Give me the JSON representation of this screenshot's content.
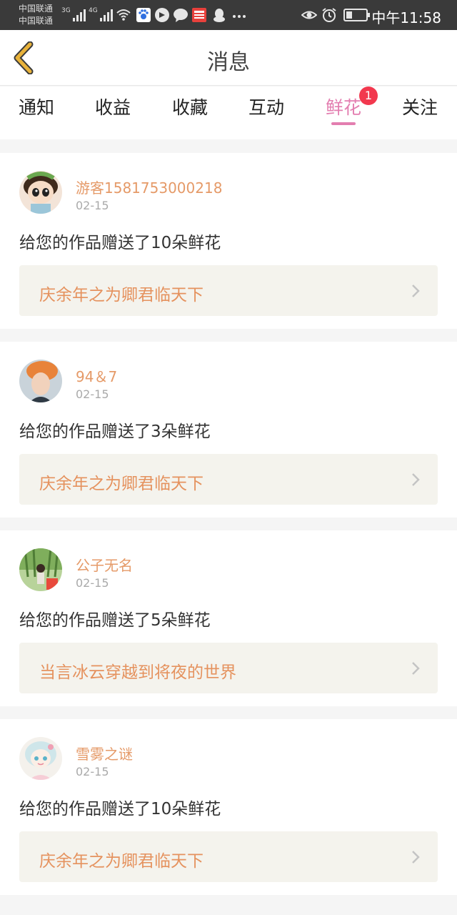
{
  "status_bar": {
    "carrier_1": "中国联通",
    "carrier_2": "中国联通",
    "net_1": "3G",
    "net_2": "4G",
    "time": "中午11:58",
    "notif_icons": [
      "baidu-icon",
      "app-icon",
      "chat-icon",
      "toutiao-icon",
      "qq-icon",
      "more-icon"
    ],
    "status_icons": [
      "eye-icon",
      "alarm-icon",
      "battery-icon"
    ]
  },
  "header": {
    "title": "消息"
  },
  "tabs": {
    "items": [
      "通知",
      "收益",
      "收藏",
      "互动",
      "鲜花",
      "关注"
    ],
    "active_index": 4,
    "flower_badge": "1",
    "active_color": "#e37eb0"
  },
  "cards": [
    {
      "user": "游客1581753000218",
      "date": "02-15",
      "message": "给您的作品赠送了10朵鲜花",
      "work": "庆余年之为卿君临天下"
    },
    {
      "user": "94＆7",
      "date": "02-15",
      "message": "给您的作品赠送了3朵鲜花",
      "work": "庆余年之为卿君临天下"
    },
    {
      "user": "公子无名",
      "date": "02-15",
      "message": "给您的作品赠送了5朵鲜花",
      "work": "当言冰云穿越到将夜的世界"
    },
    {
      "user": "雪雾之谜",
      "date": "02-15",
      "message": "给您的作品赠送了10朵鲜花",
      "work": "庆余年之为卿君临天下"
    }
  ],
  "colors": {
    "username": "#e59a68",
    "work_title": "#e5925e",
    "badge": "#f2384e",
    "back_arrow": "#e8b23a"
  }
}
